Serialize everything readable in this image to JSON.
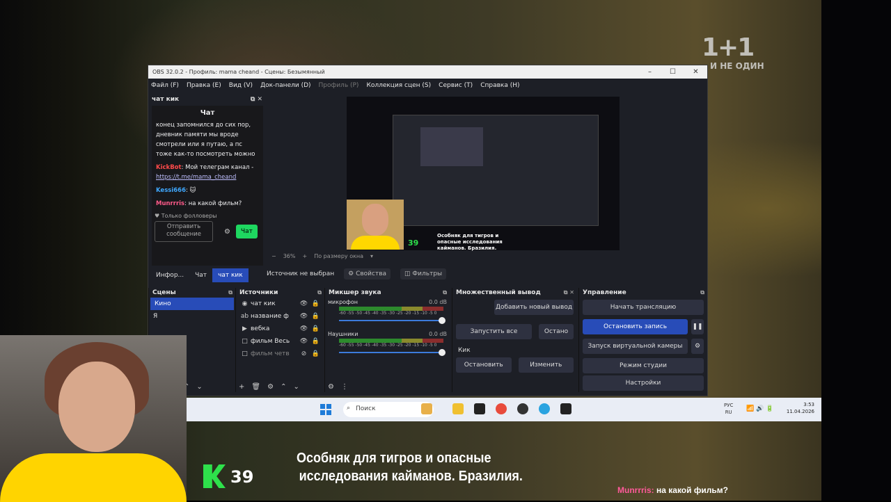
{
  "background": {
    "tv_logo": "1+1",
    "tv_sub": "И НЕ ОДИН"
  },
  "obs": {
    "title": "OBS 32.0.2 - Профиль: mama cheand - Сцены: Безымянный",
    "menu": [
      "Файл (F)",
      "Правка (E)",
      "Вид (V)",
      "Док-панели (D)",
      "Профиль (P)",
      "Коллекция сцен (S)",
      "Сервис (T)",
      "Справка (H)"
    ],
    "chat_dock": {
      "title": "чат кик",
      "panel_title": "Чат",
      "messages": [
        {
          "nick": "",
          "text": "конец запомнился до сих пор, дневник памяти мы вроде смотрели или я путаю, а пс тоже как-то посмотреть можно"
        },
        {
          "nick": "KickBot",
          "text": ": Мой телеграм канал -",
          "link": "https://t.me/mama_cheand"
        },
        {
          "nick": "Kessi666",
          "text": ":"
        },
        {
          "nick": "Munrrris",
          "text": ": на какой фильм?"
        }
      ],
      "followers_only": "Только фолловеры",
      "send_placeholder": "Отправить сообщение",
      "chat_button": "Чат",
      "tabs": [
        "Инфор...",
        "Чат",
        "чат кик"
      ]
    },
    "preview": {
      "zoom": "36%",
      "fit": "По размеру окна",
      "caption": "Особняк для тигров и опасные исследования кайманов. Бразилия.",
      "k_number": "39",
      "tv_logo": "1+1"
    },
    "source_bar": {
      "no_source": "Источник не выбран",
      "properties": "Свойства",
      "filters": "Фильтры"
    },
    "scenes": {
      "title": "Сцены",
      "items": [
        "Кино",
        "Я"
      ]
    },
    "sources": {
      "title": "Источники",
      "items": [
        "чат кик",
        "название ф",
        "вебка",
        "фильм Весь",
        "фильм четв"
      ]
    },
    "mixer": {
      "title": "Микшер звука",
      "channels": [
        {
          "name": "микрофон",
          "db": "0.0 dB"
        },
        {
          "name": "Наушники",
          "db": "0.0 dB"
        }
      ],
      "ticks": "-60 -55 -50 -45 -40 -35 -30 -25 -20 -15 -10 -5 0"
    },
    "multi_output": {
      "title": "Множественный вывод",
      "add": "Добавить новый вывод",
      "start_all": "Запустить все",
      "stop_all": "Остано",
      "platform": "Кик",
      "stop": "Остановить",
      "edit": "Изменить"
    },
    "controls": {
      "title": "Управление",
      "start_stream": "Начать трансляцию",
      "stop_record": "Остановить запись",
      "virtual_cam": "Запуск виртуальной камеры",
      "studio": "Режим студии",
      "settings": "Настройки"
    }
  },
  "taskbar": {
    "search": "Поиск",
    "lang1": "РУС",
    "lang2": "RU",
    "time": "3:53",
    "date": "11.04.2026"
  },
  "overlay": {
    "k_number": "39",
    "caption_line1": "Особняк для тигров и опасные",
    "caption_line2": "исследования кайманов. Бразилия.",
    "chat_nick": "Munrrris:",
    "chat_text": "на какой фильм?"
  }
}
